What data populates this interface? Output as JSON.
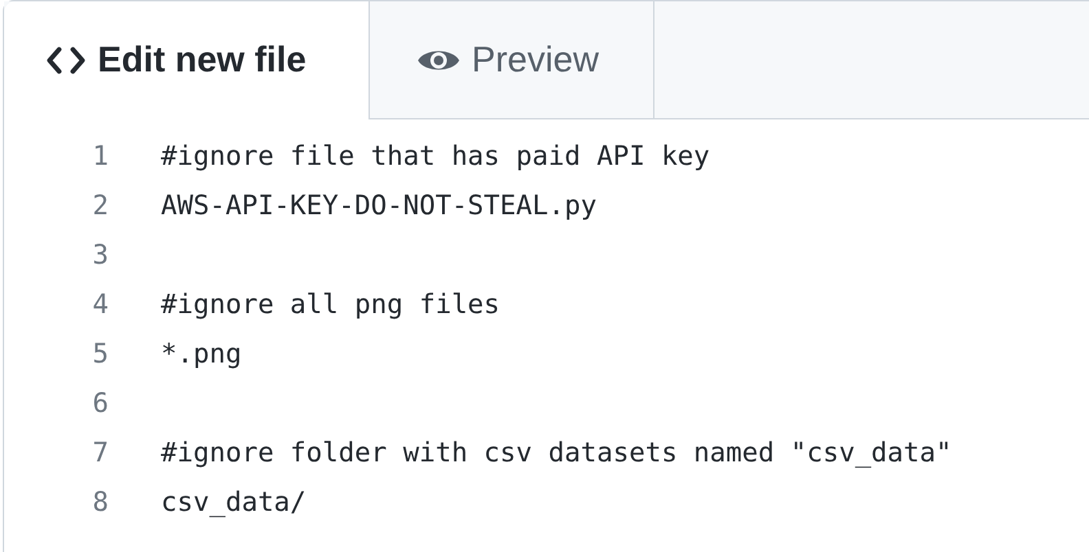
{
  "tabs": [
    {
      "label": "Edit new file",
      "selected": true
    },
    {
      "label": "Preview",
      "selected": false
    }
  ],
  "lines": [
    {
      "number": "1",
      "code": "#ignore file that has paid API key"
    },
    {
      "number": "2",
      "code": "AWS-API-KEY-DO-NOT-STEAL.py"
    },
    {
      "number": "3"
    },
    {
      "number": "4",
      "code": "#ignore all png files"
    },
    {
      "number": "5",
      "code": "*.png"
    },
    {
      "number": "6"
    },
    {
      "number": "7",
      "code": "#ignore folder with csv datasets named \"csv_data\""
    },
    {
      "number": "8",
      "code": "csv_data/"
    }
  ]
}
